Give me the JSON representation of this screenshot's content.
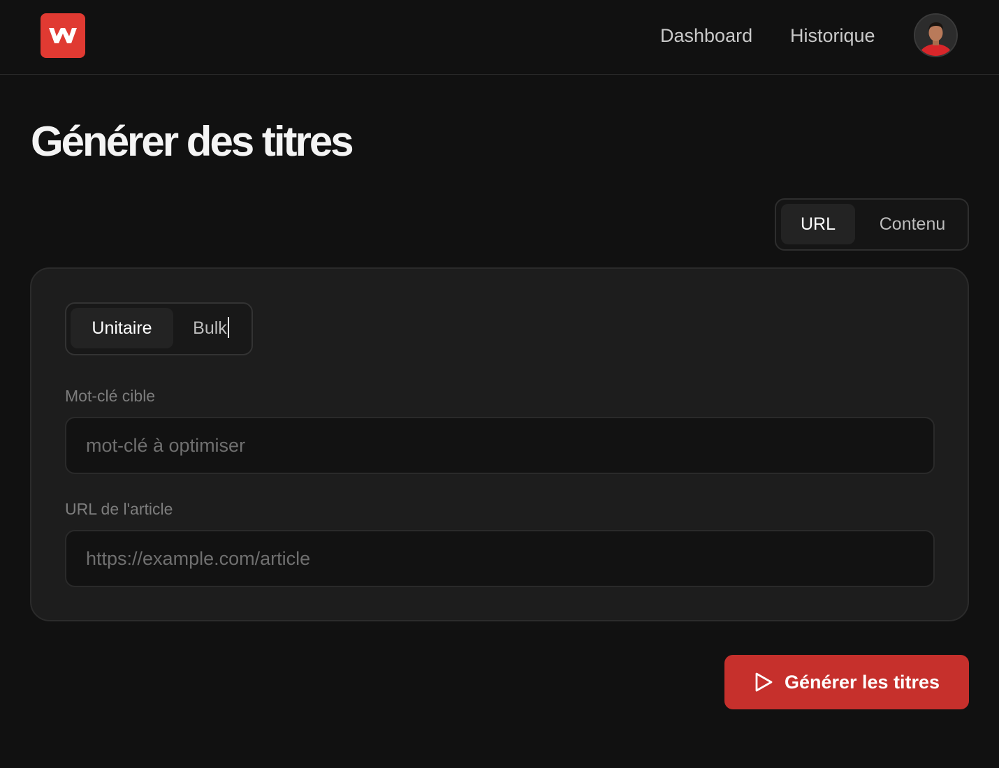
{
  "header": {
    "logo_icon": "w-logo-icon",
    "nav": {
      "dashboard": "Dashboard",
      "history": "Historique"
    },
    "avatar_icon": "user-avatar"
  },
  "page": {
    "title": "Générer des titres"
  },
  "mode_toggle": {
    "url": "URL",
    "contenu": "Contenu",
    "selected": "URL"
  },
  "card": {
    "type_toggle": {
      "unitaire": "Unitaire",
      "bulk": "Bulk",
      "selected": "Unitaire"
    },
    "keyword": {
      "label": "Mot-clé cible",
      "placeholder": "mot-clé à optimiser",
      "value": ""
    },
    "url": {
      "label": "URL de l'article",
      "placeholder": "https://example.com/article",
      "value": ""
    }
  },
  "generate_button": {
    "label": "Générer les titres",
    "icon": "play-icon"
  },
  "colors": {
    "background": "#111111",
    "card": "#1d1d1d",
    "accent": "#c6302c",
    "logo": "#e03a32"
  }
}
